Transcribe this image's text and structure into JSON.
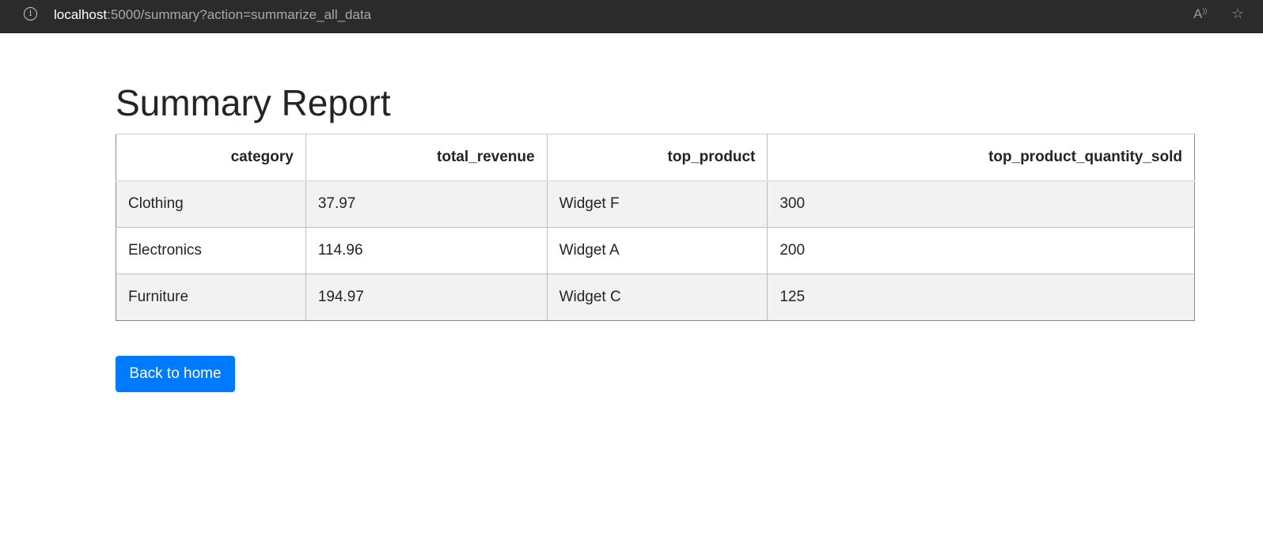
{
  "browser": {
    "url_host": "localhost",
    "url_rest": ":5000/summary?action=summarize_all_data",
    "info_icon": "info-icon",
    "read_aloud_icon": "read-aloud-icon",
    "favorite_icon": "star-icon"
  },
  "page": {
    "title": "Summary Report"
  },
  "table": {
    "headers": [
      "category",
      "total_revenue",
      "top_product",
      "top_product_quantity_sold"
    ],
    "rows": [
      [
        "Clothing",
        "37.97",
        "Widget F",
        "300"
      ],
      [
        "Electronics",
        "114.96",
        "Widget A",
        "200"
      ],
      [
        "Furniture",
        "194.97",
        "Widget C",
        "125"
      ]
    ]
  },
  "actions": {
    "back_label": "Back to home"
  },
  "colors": {
    "button_primary": "#007bff",
    "stripe": "#f2f2f2",
    "browser_bar": "#2b2b2b"
  }
}
